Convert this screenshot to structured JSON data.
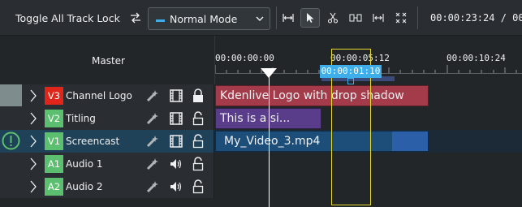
{
  "toolbar": {
    "toggle_lock": "Toggle All Track Lock",
    "mode": "Normal Mode",
    "timecode": "00:00:23:24 / 00",
    "icons": [
      "switch-icon",
      "mode-icon",
      "chevron-down-icon",
      "spacer-tool-icon",
      "select-tool-icon",
      "razor-tool-icon",
      "ripple-icon",
      "slip-icon",
      "multicam-icon"
    ]
  },
  "ruler": {
    "master": "Master",
    "ticks": [
      "00:00:00:00",
      "00:00:05:12",
      "00:00:10:24"
    ],
    "cursor_time": "00:00:01:10"
  },
  "tracks": [
    {
      "id": "V3",
      "name": "Channel Logo",
      "badge_color": "#e0251b",
      "marker_color": "#7f8c8d",
      "type": "video",
      "locked": true
    },
    {
      "id": "V2",
      "name": "Titling",
      "badge_color": "#5cbf6f",
      "marker_color": "",
      "type": "video",
      "locked": false
    },
    {
      "id": "V1",
      "name": "Screencast",
      "badge_color": "#5cbf6f",
      "marker_color": "#5cbf6f",
      "type": "video",
      "locked": false
    },
    {
      "id": "A1",
      "name": "Audio 1",
      "badge_color": "#5cbf6f",
      "marker_color": "",
      "type": "audio",
      "locked": false
    },
    {
      "id": "A2",
      "name": "Audio 2",
      "badge_color": "#5cbf6f",
      "marker_color": "",
      "type": "audio",
      "locked": false
    }
  ],
  "clips": {
    "logo": "Kdenlive Logo with drop shadow",
    "title": "This is a si...",
    "video": "My_Video_3.mp4"
  },
  "colors": {
    "accent": "#3daee9",
    "logo_clip": "#a33b4a",
    "title_clip": "#5a3d8a",
    "video_clip": "#1d4e7a",
    "selection": "#e6d92e"
  }
}
